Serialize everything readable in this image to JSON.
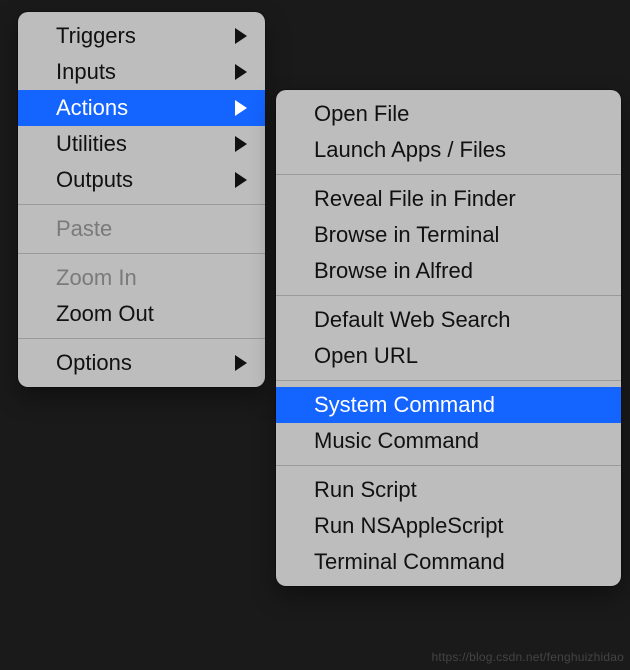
{
  "main_menu": {
    "items": [
      {
        "label": "Triggers",
        "has_submenu": true,
        "enabled": true,
        "selected": false
      },
      {
        "label": "Inputs",
        "has_submenu": true,
        "enabled": true,
        "selected": false
      },
      {
        "label": "Actions",
        "has_submenu": true,
        "enabled": true,
        "selected": true
      },
      {
        "label": "Utilities",
        "has_submenu": true,
        "enabled": true,
        "selected": false
      },
      {
        "label": "Outputs",
        "has_submenu": true,
        "enabled": true,
        "selected": false
      }
    ],
    "paste": {
      "label": "Paste",
      "has_submenu": false,
      "enabled": false,
      "selected": false
    },
    "zoom_in": {
      "label": "Zoom In",
      "has_submenu": false,
      "enabled": false,
      "selected": false
    },
    "zoom_out": {
      "label": "Zoom Out",
      "has_submenu": false,
      "enabled": true,
      "selected": false
    },
    "options": {
      "label": "Options",
      "has_submenu": true,
      "enabled": true,
      "selected": false
    }
  },
  "actions_submenu": {
    "group1": [
      {
        "label": "Open File",
        "selected": false
      },
      {
        "label": "Launch Apps / Files",
        "selected": false
      }
    ],
    "group2": [
      {
        "label": "Reveal File in Finder",
        "selected": false
      },
      {
        "label": "Browse in Terminal",
        "selected": false
      },
      {
        "label": "Browse in Alfred",
        "selected": false
      }
    ],
    "group3": [
      {
        "label": "Default Web Search",
        "selected": false
      },
      {
        "label": "Open URL",
        "selected": false
      }
    ],
    "group4": [
      {
        "label": "System Command",
        "selected": true
      },
      {
        "label": "Music Command",
        "selected": false
      }
    ],
    "group5": [
      {
        "label": "Run Script",
        "selected": false
      },
      {
        "label": "Run NSAppleScript",
        "selected": false
      },
      {
        "label": "Terminal Command",
        "selected": false
      }
    ]
  },
  "watermark": "https://blog.csdn.net/fenghuizhidao"
}
